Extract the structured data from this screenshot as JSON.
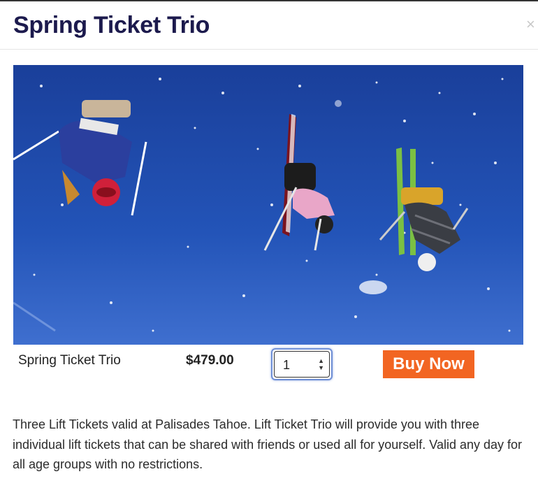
{
  "modal": {
    "title": "Spring Ticket Trio",
    "close_glyph": "×"
  },
  "product": {
    "name": "Spring Ticket Trio",
    "price": "$479.00",
    "quantity": "1",
    "buy_label": "Buy Now",
    "description": "Three Lift Tickets valid at Palisades Tahoe. Lift Ticket Trio will provide you with three individual lift tickets that can be shared with friends or used all for yourself. Valid any day for all age groups with no restrictions."
  },
  "colors": {
    "title": "#1c1a4d",
    "buy_button": "#f26522",
    "sky": "#1f4aa8"
  },
  "icons": [
    "close-icon",
    "select-arrows-icon"
  ]
}
